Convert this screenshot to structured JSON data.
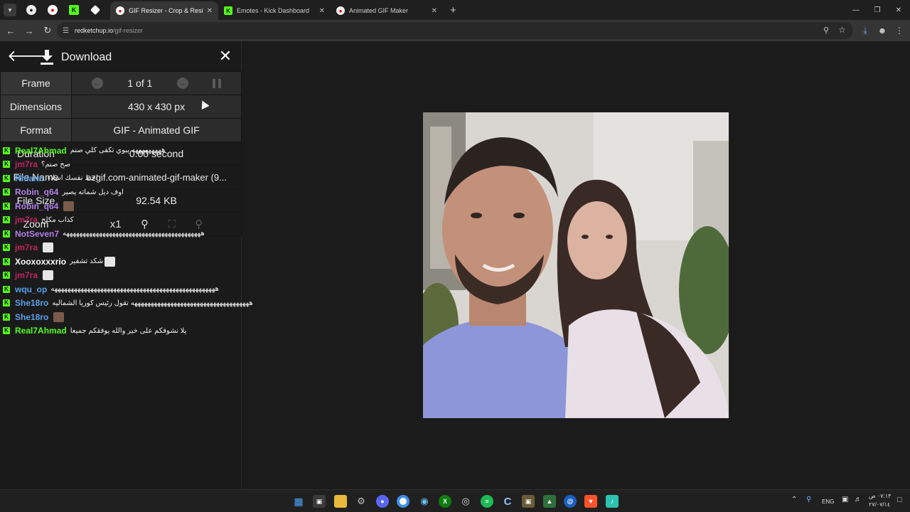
{
  "browser": {
    "tabs": [
      {
        "title": "GIF Resizer - Crop & Resize Animated GIFs",
        "favicon": "ezgif-favicon",
        "active": true
      },
      {
        "title": "Emotes - Kick Dashboard",
        "favicon": "kick-favicon",
        "active": false
      },
      {
        "title": "Animated GIF Maker",
        "favicon": "ezgif-favicon",
        "active": false
      }
    ],
    "url_host": "redketchup.io",
    "url_path": "/gif-resizer"
  },
  "panel": {
    "download_label": "Download",
    "rows": [
      {
        "key": "Frame",
        "value": "1 of 1"
      },
      {
        "key": "Dimensions",
        "value": "430 x 430 px"
      },
      {
        "key": "Format",
        "value": "GIF - Animated GIF"
      },
      {
        "key": "Duration",
        "value": "0.00 second"
      },
      {
        "key": "File Name",
        "value": "ezgif.com-animated-gif-maker (9..."
      },
      {
        "key": "File Size",
        "value": "92.54 KB"
      },
      {
        "key": "Zoom",
        "value": "x1"
      }
    ]
  },
  "chat": [
    {
      "user": "Real7Ahmad",
      "color": "#53fc18",
      "msg": "هههههههههه يبوي تكفى كلي صنم",
      "emote": ""
    },
    {
      "user": "jm7ra",
      "color": "#c0245c",
      "msg": "صح صنم؟",
      "emote": ""
    },
    {
      "user": "Rhiann",
      "color": "#57a0e8",
      "msg": "احط نفسك اسلاء",
      "emote": ""
    },
    {
      "user": "Robin_q64",
      "color": "#b17fe8",
      "msg": "اوف ديل شماته يصير",
      "emote": ""
    },
    {
      "user": "Robin_q64",
      "color": "#b17fe8",
      "msg": "",
      "emote": "img"
    },
    {
      "user": "jm7ra",
      "color": "#c0245c",
      "msg": "كذاب مكلح",
      "emote": ""
    },
    {
      "user": "NotSeven7",
      "color": "#b17fe8",
      "msg": "ههههههههههههههههههههههههههههههههههههههههههه",
      "emote": ""
    },
    {
      "user": "jm7ra",
      "color": "#c0245c",
      "msg": "",
      "emote": "plain"
    },
    {
      "user": "Xooxoxxxrio",
      "color": "#ffffff",
      "msg": "شكد تشفير",
      "emote": "plain"
    },
    {
      "user": "jm7ra",
      "color": "#c0245c",
      "msg": "",
      "emote": "plain"
    },
    {
      "user": "wqu_op",
      "color": "#57a0e8",
      "msg": "ههههههههههههههههههههههههههههههههههههههههههههههههههه",
      "emote": ""
    },
    {
      "user": "She18ro",
      "color": "#57a0e8",
      "msg": "ههههههههههههههههههههههههههههههههههههه تقول رئيس كوريا الشماليه",
      "emote": ""
    },
    {
      "user": "She18ro",
      "color": "#57a0e8",
      "msg": "",
      "emote": "img"
    },
    {
      "user": "Real7Ahmad",
      "color": "#53fc18",
      "msg": "يلا نشوفكم على خير والله يوفقكم جميعا",
      "emote": ""
    }
  ],
  "taskbar": {
    "language": "ENG",
    "time": "٠٧:١٣ ص",
    "date": "٢٧/٠٧/١٤"
  }
}
